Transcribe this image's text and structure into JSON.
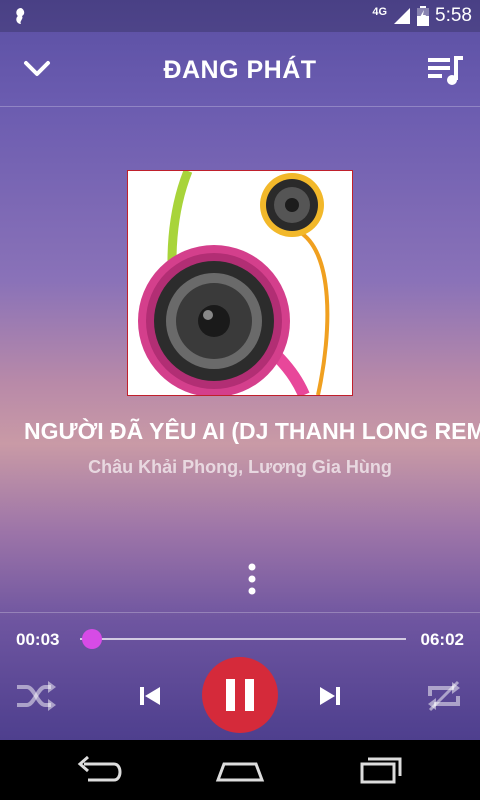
{
  "status_bar": {
    "network": "4G",
    "time": "5:58"
  },
  "header": {
    "title": "ĐANG PHÁT",
    "back_icon": "chevron-down-icon",
    "queue_icon": "playlist-icon"
  },
  "now_playing": {
    "title": "NGƯỜI ĐÃ YÊU AI (DJ THANH LONG REMIX)",
    "artist": "Châu Khải Phong, Lương Gia Hùng"
  },
  "progress": {
    "current": "00:03",
    "total": "06:02",
    "fraction": 0.008
  },
  "controls": {
    "shuffle_icon": "shuffle-icon",
    "prev_icon": "skip-previous-icon",
    "play_state": "pause",
    "next_icon": "skip-next-icon",
    "repeat_icon": "repeat-off-icon"
  },
  "colors": {
    "accent": "#d52a3a",
    "seek_thumb": "#d64be6"
  }
}
